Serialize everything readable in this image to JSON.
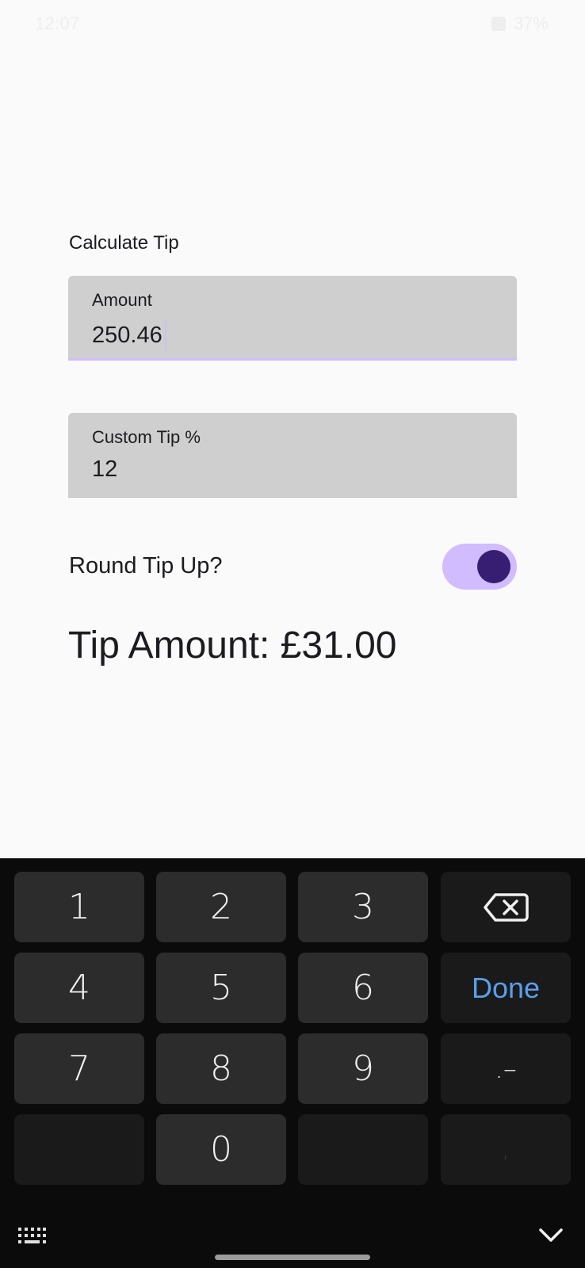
{
  "status_bar": {
    "time": "12:07",
    "right_text": "37%"
  },
  "app": {
    "title": "Calculate Tip",
    "amount_field": {
      "label": "Amount",
      "value": "250.46"
    },
    "tip_field": {
      "label": "Custom Tip %",
      "value": "12"
    },
    "round_toggle": {
      "label": "Round Tip Up?",
      "checked": true
    },
    "result": "Tip Amount: £31.00"
  },
  "colors": {
    "background": "#fafafa",
    "field_bg": "#cfcfcf",
    "accent_light": "#d0bcff",
    "accent_dark": "#381e72",
    "keyboard_bg": "#0b0b0b",
    "key_bg": "#2c2c2c",
    "done_text": "#5a9fea"
  },
  "keyboard": {
    "keys": {
      "k1": "1",
      "k2": "2",
      "k3": "3",
      "k4": "4",
      "k5": "5",
      "k6": "6",
      "k7": "7",
      "k8": "8",
      "k9": "9",
      "k0": "0",
      "done": "Done",
      "dot_dash": ".–",
      "comma": ","
    },
    "icons": {
      "backspace": "backspace-icon",
      "keyboard_switch": "keyboard-grid-icon",
      "hide": "chevron-down-icon"
    }
  }
}
